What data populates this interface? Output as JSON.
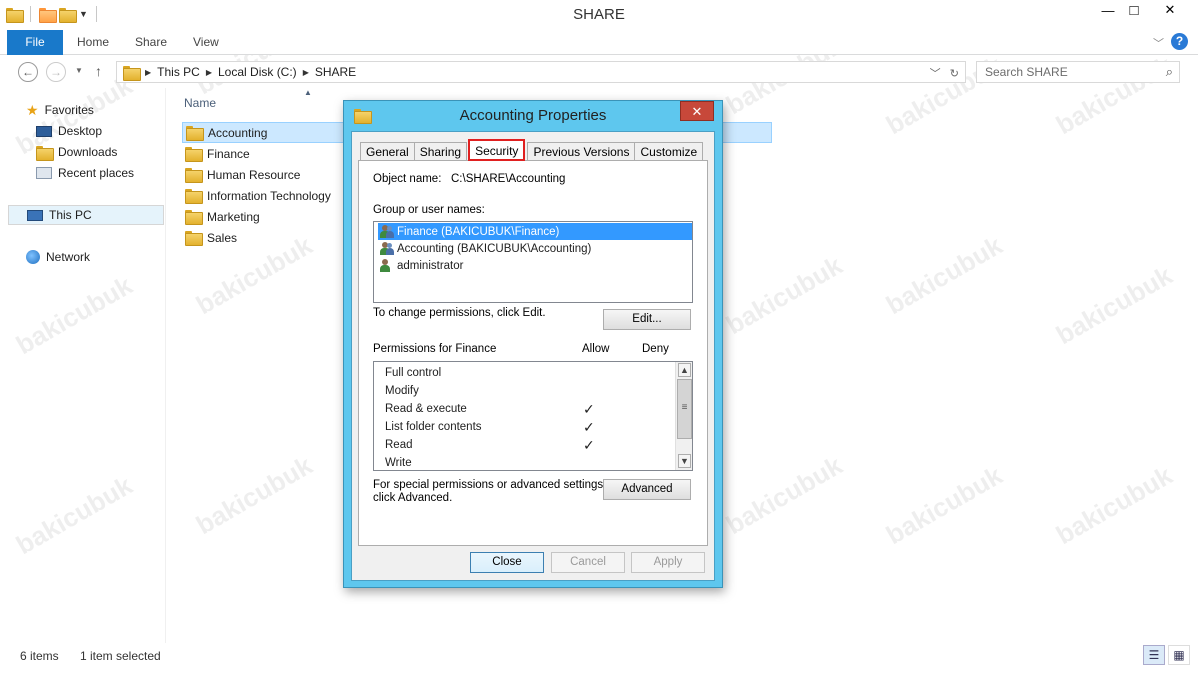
{
  "window": {
    "title": "SHARE",
    "minimize": "—",
    "maximize": "□",
    "close": "✕"
  },
  "ribbon": {
    "tabs": [
      "File",
      "Home",
      "Share",
      "View"
    ],
    "help": "?"
  },
  "address": {
    "crumbs": [
      "This PC",
      "Local Disk (C:)",
      "SHARE"
    ],
    "search_placeholder": "Search SHARE"
  },
  "navpane": {
    "favorites": "Favorites",
    "desktop": "Desktop",
    "downloads": "Downloads",
    "recent": "Recent places",
    "thispc": "This PC",
    "network": "Network"
  },
  "filelist": {
    "column_name": "Name",
    "items": [
      "Accounting",
      "Finance",
      "Human Resource",
      "Information Technology",
      "Marketing",
      "Sales"
    ],
    "selected": "Accounting"
  },
  "status": {
    "items": "6 items",
    "selected": "1 item selected"
  },
  "dialog": {
    "title": "Accounting Properties",
    "close": "✕",
    "tabs": [
      "General",
      "Sharing",
      "Security",
      "Previous Versions",
      "Customize"
    ],
    "active_tab": "Security",
    "object_label": "Object name:",
    "object_value": "C:\\SHARE\\Accounting",
    "group_label": "Group or user names:",
    "users": [
      {
        "name": "Finance (BAKICUBUK\\Finance)",
        "icon": "group-icon"
      },
      {
        "name": "Accounting (BAKICUBUK\\Accounting)",
        "icon": "group-icon"
      },
      {
        "name": "administrator",
        "icon": "user-icon"
      }
    ],
    "change_text": "To change permissions, click Edit.",
    "edit_button": "Edit...",
    "perm_header": "Permissions for Finance",
    "allow": "Allow",
    "deny": "Deny",
    "permissions": [
      {
        "name": "Full control",
        "allow": "",
        "deny": ""
      },
      {
        "name": "Modify",
        "allow": "",
        "deny": ""
      },
      {
        "name": "Read & execute",
        "allow": "✓",
        "deny": ""
      },
      {
        "name": "List folder contents",
        "allow": "✓",
        "deny": ""
      },
      {
        "name": "Read",
        "allow": "✓",
        "deny": ""
      },
      {
        "name": "Write",
        "allow": "",
        "deny": ""
      }
    ],
    "special_text_1": "For special permissions or advanced settings,",
    "special_text_2": "click Advanced.",
    "advanced_button": "Advanced",
    "close_button": "Close",
    "cancel_button": "Cancel",
    "apply_button": "Apply"
  },
  "watermark": "bakicubuk",
  "colors": {
    "dialog_frame": "#5ec7ee",
    "selection": "#3399ff",
    "file_tab": "#1979ca",
    "active_tab_border": "#e02020"
  }
}
